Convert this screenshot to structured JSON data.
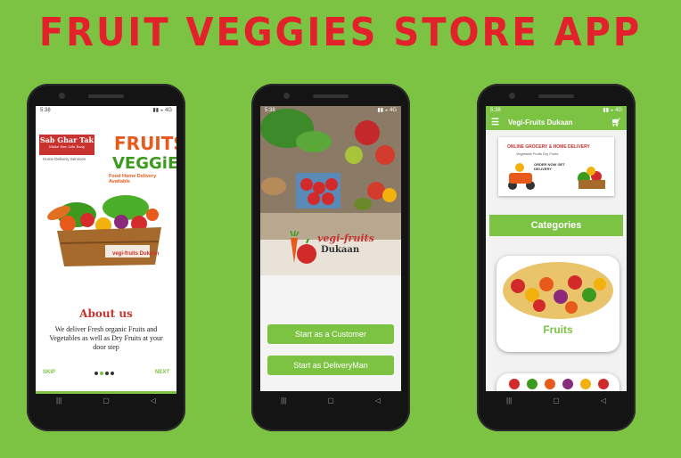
{
  "header": {
    "title": "FRUIT VEGGIES STORE APP"
  },
  "colors": {
    "background": "#7cc243",
    "title": "#e3212b",
    "accent": "#7cc243",
    "brand_red": "#c8322f"
  },
  "phone1": {
    "status_time": "5:38",
    "brand_name": "Sab Ghar Tak",
    "brand_tagline": "Make Her Life Easy",
    "brand_subtitle": "Home Delivery Services",
    "logo_fruits": "FRUITS",
    "logo_veggies": "VEGGiES",
    "logo_tag": "Food Home Delivery Available",
    "about_title": "About us",
    "about_text": "We deliver Fresh organic Fruits and Vegetables as well as Dry Fruits at your door step",
    "skip_label": "SKIP",
    "next_label": "NEXT",
    "basket_label": "vegi-fruits Dukaan"
  },
  "phone2": {
    "status_time": "5:38",
    "logo_top": "vegi-fruits",
    "logo_bottom": "Dukaan",
    "customer_button": "Start as a Customer",
    "delivery_button": "Start as DeliveryMan"
  },
  "phone3": {
    "status_time": "5:38",
    "app_title": "Vegi-Fruits Dukaan",
    "banner_headline": "ONLINE GROCERY & HOME DELIVERY",
    "banner_sub": "Vegetable Fruits Dry Fruits",
    "banner_order": "ORDER NOW GET DELIVERY",
    "categories_label": "Categories",
    "category_1": "Fruits"
  }
}
